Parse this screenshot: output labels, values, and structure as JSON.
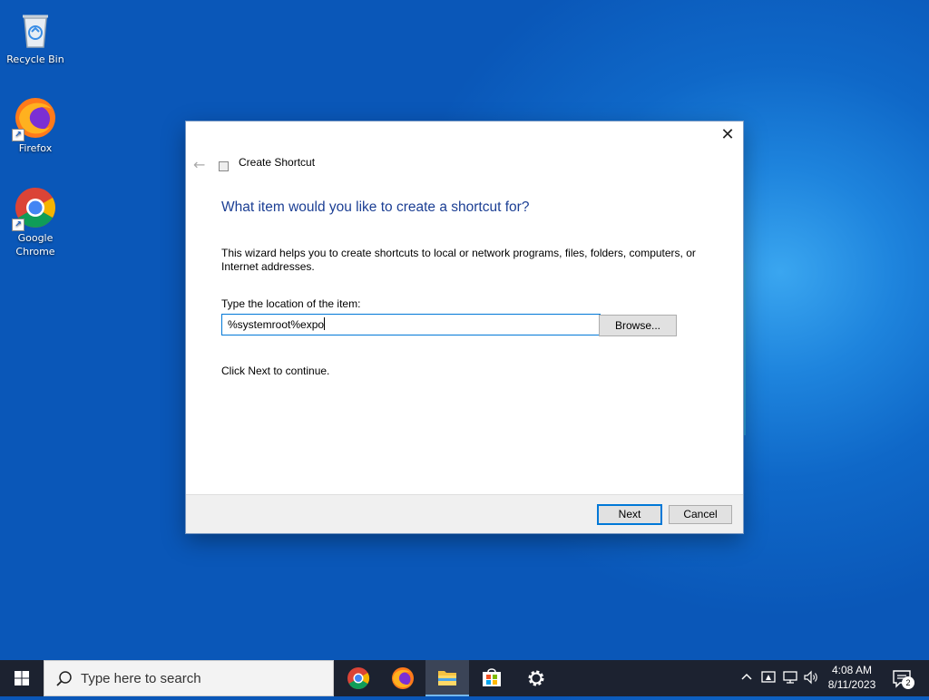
{
  "desktop": {
    "icons": [
      {
        "label": "Recycle Bin",
        "icon": "recycle-bin-icon"
      },
      {
        "label": "Firefox",
        "icon": "firefox-icon"
      },
      {
        "label": "Google Chrome",
        "icon": "chrome-icon"
      }
    ]
  },
  "dialog": {
    "title": "Create Shortcut",
    "heading": "What item would you like to create a shortcut for?",
    "description": "This wizard helps you to create shortcuts to local or network programs, files, folders, computers, or Internet addresses.",
    "location_label": "Type the location of the item:",
    "location_value": "%systemroot%expo",
    "browse_label": "Browse...",
    "hint": "Click Next to continue.",
    "next_label": "Next",
    "cancel_label": "Cancel",
    "close_glyph": "✕",
    "back_glyph": "←",
    "accent_color": "#0078d7",
    "heading_color": "#1c3f94"
  },
  "taskbar": {
    "search_placeholder": "Type here to search",
    "apps": [
      "chrome-icon",
      "firefox-icon",
      "file-explorer-icon",
      "store-icon",
      "settings-icon"
    ],
    "active_app": "file-explorer-icon",
    "clock_time": "4:08 AM",
    "clock_date": "8/11/2023",
    "notification_count": "2",
    "tray_chevron": "^"
  }
}
